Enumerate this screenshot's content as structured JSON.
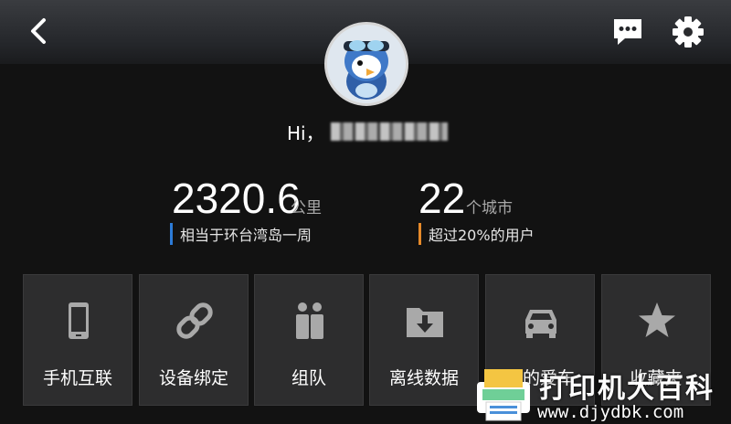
{
  "header": {
    "back_icon": "chevron-left-icon",
    "message_icon": "chat-bubble-icon",
    "settings_icon": "gear-icon"
  },
  "profile": {
    "greeting": "Hi，",
    "avatar_icon": "penguin-avatar-icon"
  },
  "stats": [
    {
      "value": "2320.6",
      "unit": "公里",
      "desc": "相当于环台湾岛一周",
      "accent": "#2c7bd7"
    },
    {
      "value": "22",
      "unit": "个城市",
      "desc": "超过20%的用户",
      "accent": "#e68a2a"
    }
  ],
  "tiles": [
    {
      "label": "手机互联",
      "icon": "phone-icon"
    },
    {
      "label": "设备绑定",
      "icon": "link-icon"
    },
    {
      "label": "组队",
      "icon": "team-icon"
    },
    {
      "label": "离线数据",
      "icon": "download-folder-icon"
    },
    {
      "label": "我的爱车",
      "icon": "car-icon"
    },
    {
      "label": "收藏夹",
      "icon": "star-icon"
    }
  ],
  "watermark": {
    "title": "打印机大百科",
    "url": "www.djydbk.com"
  }
}
